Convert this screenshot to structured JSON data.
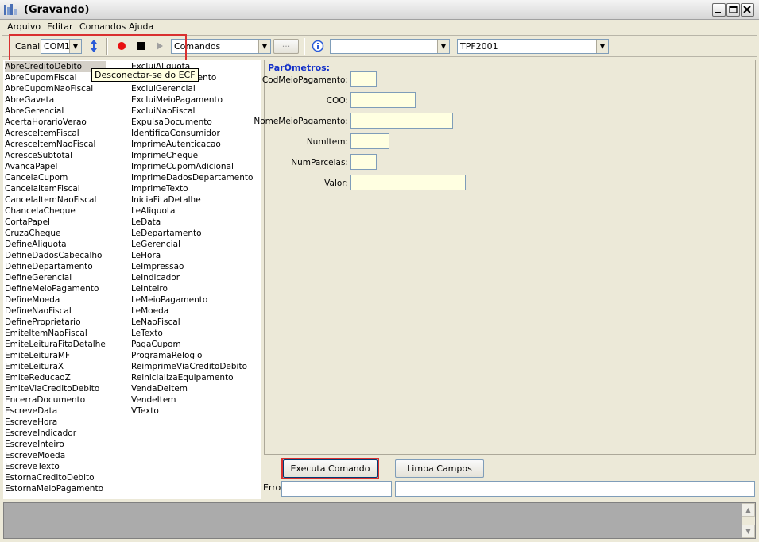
{
  "window": {
    "title": "(Gravando)"
  },
  "menu": [
    "Arquivo",
    "Editar",
    "Comandos",
    "Ajuda"
  ],
  "toolbar": {
    "canal_label": "Canal:",
    "canal_value": "COM1",
    "commands_value": "Comandos",
    "ellipsis_label": "···",
    "combo2_value": "",
    "tpf_value": "TPF2001",
    "tooltip": "Desconectar-se do ECF"
  },
  "commands_col1": [
    "AbreCreditoDebito",
    "AbreCupomFiscal",
    "AbreCupomNaoFiscal",
    "AbreGaveta",
    "AbreGerencial",
    "AcertaHorarioVerao",
    "AcresceItemFiscal",
    "AcresceItemNaoFiscal",
    "AcresceSubtotal",
    "AvancaPapel",
    "CancelaCupom",
    "CancelaItemFiscal",
    "CancelaItemNaoFiscal",
    "ChancelaCheque",
    "CortaPapel",
    "CruzaCheque",
    "DefineAliquota",
    "DefineDadosCabecalho",
    "DefineDepartamento",
    "DefineGerencial",
    "DefineMeioPagamento",
    "DefineMoeda",
    "DefineNaoFiscal",
    "DefineProprietario",
    "EmiteItemNaoFiscal",
    "EmiteLeituraFitaDetalhe",
    "EmiteLeituraMF",
    "EmiteLeituraX",
    "EmiteReducaoZ",
    "EmiteViaCreditoDebito",
    "EncerraDocumento",
    "EscreveData",
    "EscreveHora",
    "EscreveIndicador",
    "EscreveInteiro",
    "EscreveMoeda",
    "EscreveTexto",
    "EstornaCreditoDebito",
    "EstornaMeioPagamento"
  ],
  "commands_col2": [
    "ExcluiAliquota",
    "ExcluiDepartamento",
    "ExcluiGerencial",
    "ExcluiMeioPagamento",
    "ExcluiNaoFiscal",
    "ExpulsaDocumento",
    "IdentificaConsumidor",
    "ImprimeAutenticacao",
    "ImprimeCheque",
    "ImprimeCupomAdicional",
    "ImprimeDadosDepartamento",
    "ImprimeTexto",
    "IniciaFitaDetalhe",
    "LeAliquota",
    "LeData",
    "LeDepartamento",
    "LeGerencial",
    "LeHora",
    "LeImpressao",
    "LeIndicador",
    "LeInteiro",
    "LeMeioPagamento",
    "LeMoeda",
    "LeNaoFiscal",
    "LeTexto",
    "PagaCupom",
    "ProgramaRelogio",
    "ReimprimeViaCreditoDebito",
    "ReinicializaEquipamento",
    "VendaDeItem",
    "VendeItem",
    "VTexto"
  ],
  "params": {
    "title": "ParÔmetros:",
    "fields": [
      {
        "label": "CodMeioPagamento:",
        "value": ""
      },
      {
        "label": "COO:",
        "value": ""
      },
      {
        "label": "NomeMeioPagamento:",
        "value": ""
      },
      {
        "label": "NumItem:",
        "value": ""
      },
      {
        "label": "NumParcelas:",
        "value": ""
      },
      {
        "label": "Valor:",
        "value": ""
      }
    ]
  },
  "buttons": {
    "execute": "Executa Comando",
    "clear": "Limpa Campos"
  },
  "error": {
    "label": "Erro:",
    "code": "",
    "message": ""
  },
  "colors": {
    "highlight_box": "#d93030",
    "params_title": "#1330c8",
    "field_bg": "#ffffe1"
  }
}
